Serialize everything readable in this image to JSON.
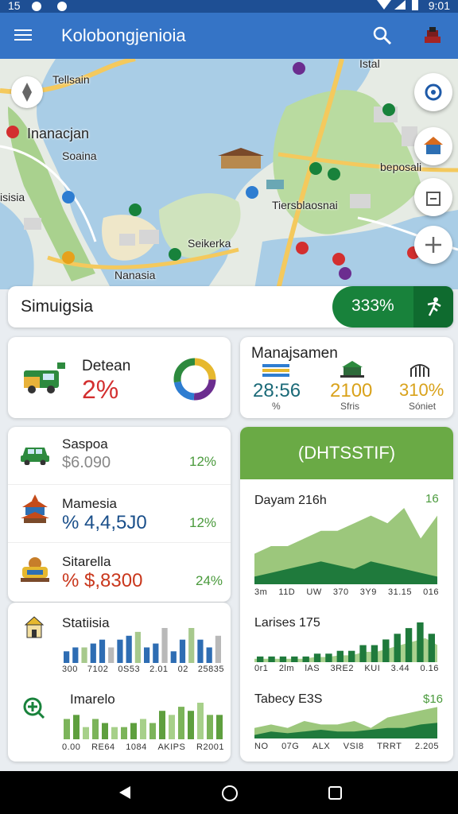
{
  "status_bar": {
    "left": "15",
    "time": "9:01"
  },
  "app_bar": {
    "title": "Kolobongjenioia"
  },
  "map": {
    "labels": [
      "Tellsain",
      "Inanacjan",
      "Soaina",
      "isisia",
      "Tiersblaosnai",
      "Seikerka",
      "Nanasia",
      "Istal",
      "beposali"
    ]
  },
  "simulation": {
    "label": "Simuigsia",
    "percent": "333%"
  },
  "detean": {
    "label": "Detean",
    "value": "2%"
  },
  "manajsamen": {
    "title": "Manajsamen",
    "values": [
      {
        "value": "28:56",
        "sub": "%",
        "color": "#1b6a78"
      },
      {
        "value": "2100",
        "sub": "Sfris",
        "color": "#d9a21b"
      },
      {
        "value": "310%",
        "sub": "Sóniet",
        "color": "#d9a21b"
      }
    ]
  },
  "list": [
    {
      "name": "Saspoa",
      "value": "$6.090",
      "pct": "12%",
      "value_color": "#888888"
    },
    {
      "name": "Mamesia",
      "value": "% 4,4,5J0",
      "pct": "12%",
      "value_color": "#1a4f8a"
    },
    {
      "name": "Sitarella",
      "value": "% $,8300",
      "pct": "24%",
      "value_color": "#c9371c"
    }
  ],
  "statisia": {
    "title": "Statiisia",
    "axis": [
      "300",
      "7102",
      "0S53",
      "2.01",
      "02",
      "25835"
    ],
    "values": [
      3,
      4,
      4,
      5,
      6,
      4,
      6,
      7,
      8,
      4,
      5,
      9,
      3,
      6,
      9,
      6,
      4,
      7
    ]
  },
  "imarelo": {
    "title": "Imarelo",
    "axis": [
      "0.00",
      "RE64",
      "1084",
      "AKIPS",
      "R2001"
    ],
    "values": [
      5,
      6,
      3,
      5,
      4,
      3,
      3,
      4,
      5,
      4,
      7,
      6,
      8,
      7,
      9,
      6,
      6
    ]
  },
  "green_card": {
    "header": "(DHTSSTIF)",
    "chart1": {
      "title": "Dayam 216h",
      "value": "16",
      "axis": [
        "3m",
        "11D",
        "UW",
        "370",
        "3Y9",
        "31.15",
        "016"
      ],
      "area_back": [
        4,
        5,
        5,
        6,
        7,
        7,
        8,
        9,
        8,
        10,
        6,
        9
      ],
      "area_front": [
        1,
        1.5,
        2,
        2.5,
        3,
        2.5,
        2,
        3,
        2.5,
        2,
        1.5,
        1
      ]
    },
    "chart2": {
      "title": "Larises 175",
      "axis": [
        "0r1",
        "2lm",
        "lAS",
        "3RE2",
        "KUI",
        "3.44",
        "0.16"
      ],
      "values": [
        1,
        1,
        1,
        1,
        1,
        1.5,
        1.5,
        2,
        2,
        3,
        3,
        4,
        5,
        6,
        7,
        5
      ]
    },
    "chart3": {
      "title": "Tabecy E3S",
      "value": "$16",
      "axis": [
        "NO",
        "07G",
        "ALX",
        "VSI8",
        "TRRT",
        "2.205"
      ],
      "area_back": [
        3,
        4,
        3,
        5,
        4,
        4,
        5,
        3,
        6,
        7,
        8,
        9
      ],
      "area_front": [
        1,
        2,
        1.5,
        2,
        2.5,
        2,
        2,
        2.5,
        3,
        3,
        4,
        4.5
      ]
    }
  },
  "colors": {
    "primary": "#3574c6",
    "accent_green": "#18823b",
    "danger": "#d32f2f"
  }
}
